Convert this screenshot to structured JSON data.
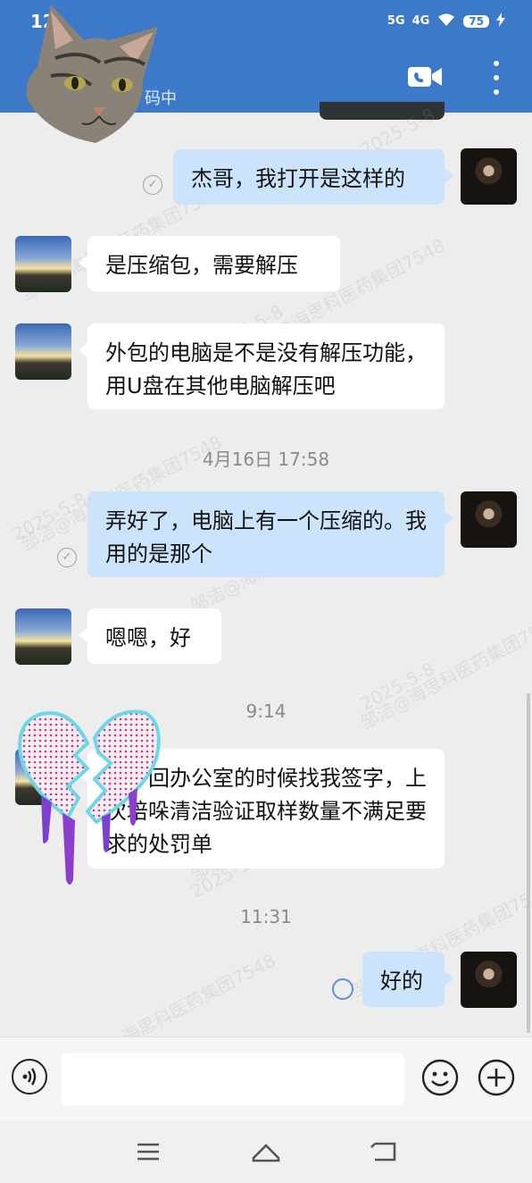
{
  "status_bar": {
    "time": "12",
    "network": "5G",
    "network2": "4G",
    "battery": "75"
  },
  "header": {
    "subtitle": "码中",
    "video_icon": "video-camera-icon",
    "more_icon": "more-vertical-icon",
    "colors": {
      "header": "#3d79c9",
      "sent_bubble": "#cce4fb",
      "received_bubble": "#ffffff"
    }
  },
  "watermark_text": {
    "line1": "邹洁@海思科医药集团7548",
    "line2": "2025-5-8"
  },
  "messages": [
    {
      "text": "杰哥，我打开是这样的",
      "side": "right"
    },
    {
      "text": "是压缩包，需要解压",
      "side": "left"
    },
    {
      "text": "外包的电脑是不是没有解压功能，用U盘在其他电脑解压吧",
      "side": "left"
    },
    {
      "text": "弄好了，电脑上有一个压缩的。我用的是那个",
      "side": "right"
    },
    {
      "text": "嗯嗯，好",
      "side": "left"
    },
    {
      "text": "洁，回办公室的时候找我签字，上次培哚清洁验证取样数量不满足要求的处罚单",
      "side": "left"
    },
    {
      "text": "好的",
      "side": "right"
    }
  ],
  "timestamps": [
    "4月16日 17:58",
    "9:14",
    "11:31"
  ],
  "input_bar": {
    "placeholder": "",
    "voice_icon": "voice-icon",
    "emoji_icon": "emoji-icon",
    "plus_icon": "plus-icon"
  },
  "nav_bar": {
    "menu_icon": "menu-icon",
    "home_icon": "home-icon",
    "back_icon": "back-icon"
  }
}
